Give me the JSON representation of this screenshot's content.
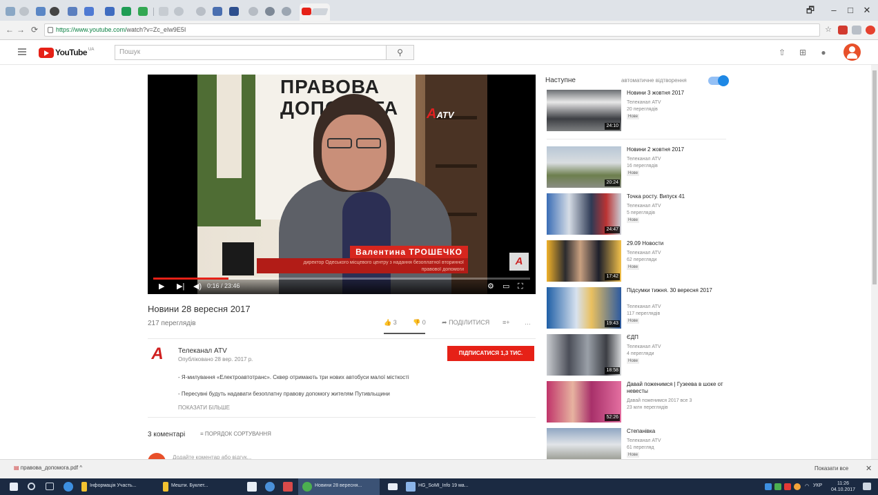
{
  "browser": {
    "url_prefix": "https://www.youtube.com/",
    "url_rest": "watch?v=Zc_eIw9E5I",
    "window_buttons": [
      "🗗",
      "–",
      "□",
      "✕"
    ],
    "nav_icons": [
      "←",
      "→",
      "⟳"
    ]
  },
  "youtube": {
    "logo_text": "YouTube",
    "logo_region": "UA",
    "search_placeholder": "Пошук",
    "search_icon": "search-icon",
    "header_icons": [
      "upload-icon",
      "apps-icon",
      "bell-icon",
      "account-avatar"
    ]
  },
  "player": {
    "board_text": "ПРАВОВА\nДОПОМОГА",
    "channel_watermark": "ATV",
    "lower_third_name": "Валентина ТРОШЕЧКО",
    "lower_third_desc": "директор Одеського місцевого центру з надання безоплатної вторинної правової допомоги",
    "time": "0:16 / 23:46",
    "progress": 0.2
  },
  "video": {
    "title": "Новини 28 вересня 2017",
    "views": "217 переглядів",
    "likes": "3",
    "dislikes": "0",
    "share": "ПОДІЛИТИСЯ",
    "more": "…",
    "channel": "Телеканал ATV",
    "published": "Опубліковано 28 вер. 2017 р.",
    "subscribe": "ПІДПИСАТИСЯ 1,3 ТИС.",
    "description_lines": [
      "- Я-милування «Електроавтотранс». Сквер отримають три нових автобуси малої місткості",
      "- Пересувні будуть надавати безоплатну правову допомогу жителям Путивльщини"
    ],
    "show_more": "ПОКАЗАТИ БІЛЬШЕ",
    "comments": "3 коментарі",
    "sort": "ПОРЯДОК СОРТУВАННЯ",
    "comment_placeholder": "Додайте коментар або відгук..."
  },
  "sidebar": {
    "up_next": "Наступне",
    "autoplay": "автоматичне відтворення",
    "items": [
      {
        "title": "Новини 3 жовтня 2017",
        "channel": "Телеканал ATV",
        "views": "20 переглядів",
        "badge": "Нове",
        "duration": "24:10"
      },
      {
        "title": "Новини 2 жовтня 2017",
        "channel": "Телеканал ATV",
        "views": "16 переглядів",
        "badge": "Нове",
        "duration": "20:24"
      },
      {
        "title": "Точка росту. Випуск 41",
        "channel": "Телеканал ATV",
        "views": "5 переглядів",
        "badge": "Нове",
        "duration": "24:47"
      },
      {
        "title": "29.09 Новости",
        "channel": "Телеканал ATV",
        "views": "62 перегляди",
        "badge": "Нове",
        "duration": "17:42"
      },
      {
        "title": "Підсумки тижня. 30 вересня 2017",
        "channel": "Телеканал ATV",
        "views": "117 переглядів",
        "badge": "Нове",
        "duration": "19:43"
      },
      {
        "title": "ЄДП",
        "channel": "Телеканал ATV",
        "views": "4 перегляди",
        "badge": "Нове",
        "duration": "18:58"
      },
      {
        "title": "Давай поженимся | Гузеева в шоке от невесты",
        "channel": "Давай поженимся 2017 все 3",
        "views": "23 млн переглядів",
        "badge": "",
        "duration": "52:26"
      },
      {
        "title": "Степанівка",
        "channel": "Телеканал ATV",
        "views": "61 перегляд",
        "badge": "Нове",
        "duration": ""
      }
    ]
  },
  "downloads": {
    "item": "правова_допомога.pdf",
    "show_all": "Показати все",
    "close": "✕"
  },
  "taskbar": {
    "items": [
      {
        "label": "Інформація Участь...",
        "color": "#f2c230"
      },
      {
        "label": "Мешти. Буклет...",
        "color": "#f2c230"
      },
      {
        "label": "Новини 28 вересня...",
        "color": "#4a90d9"
      },
      {
        "label": "HG_SoMI_Info 19 ма...",
        "color": "#8ab4e8"
      }
    ],
    "lang": "УКР",
    "time": "11:26",
    "date": "04.10.2017"
  },
  "colors": {
    "youtube_red": "#e62117",
    "autoplay_blue": "#1e88e5",
    "taskbar": "#1b2a42"
  }
}
